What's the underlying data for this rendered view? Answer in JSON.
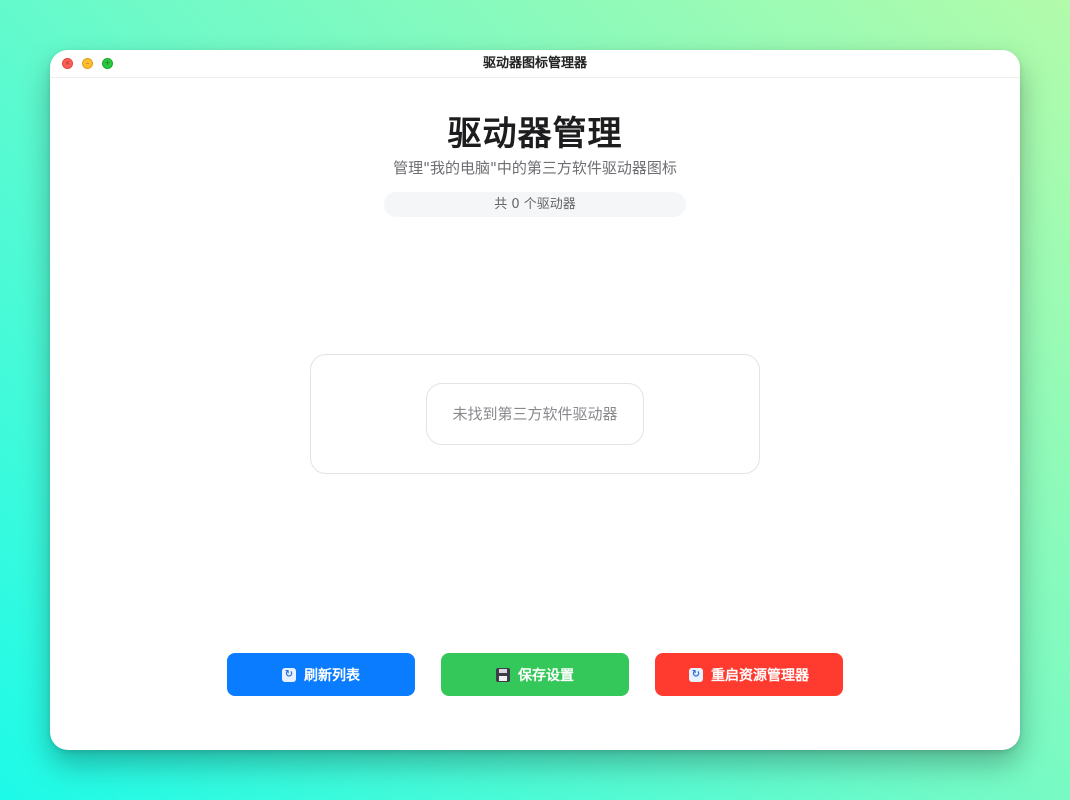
{
  "window": {
    "title": "驱动器图标管理器"
  },
  "header": {
    "title": "驱动器管理",
    "subtitle": "管理\"我的电脑\"中的第三方软件驱动器图标",
    "count_text": "共 0 个驱动器"
  },
  "main": {
    "empty_message": "未找到第三方软件驱动器"
  },
  "actions": {
    "refresh_label": "刷新列表",
    "save_label": "保存设置",
    "restart_label": "重启资源管理器"
  },
  "icons": {
    "refresh": "refresh-icon",
    "save": "floppy-disk-icon",
    "restart": "restart-icon"
  },
  "colors": {
    "refresh_button": "#0a7cff",
    "save_button": "#34c759",
    "restart_button": "#ff3b30"
  }
}
